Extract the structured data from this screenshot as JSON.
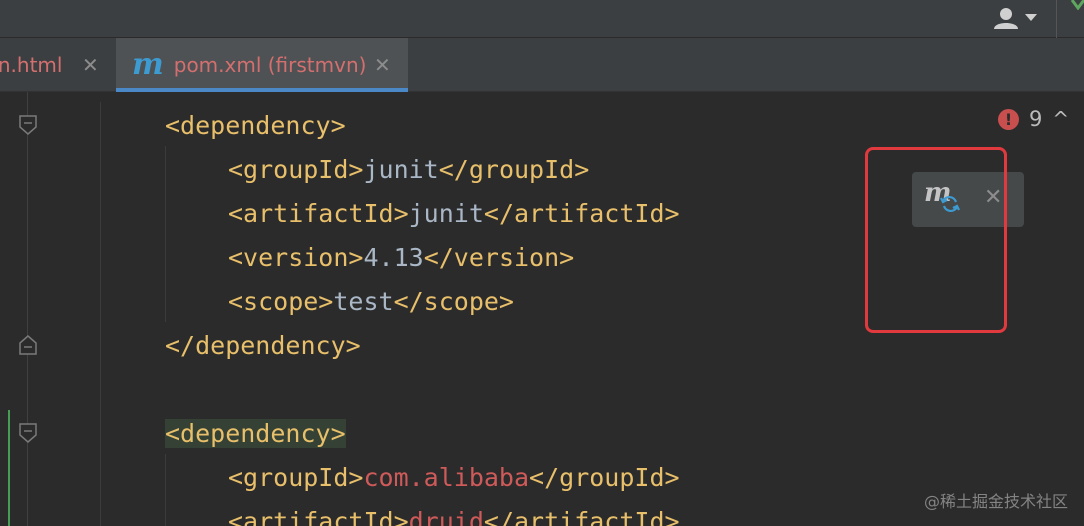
{
  "toolbar": {
    "user_icon": "user-icon",
    "dropdown_icon": "chevron-down-icon"
  },
  "tabs": [
    {
      "label": "rn.html",
      "close": "✕",
      "active": false
    },
    {
      "logo": "m",
      "label": "pom.xml (firstmvn)",
      "close": "✕",
      "active": true
    }
  ],
  "inspection": {
    "error_icon": "!",
    "count": "9",
    "arrow": "^"
  },
  "maven_popup": {
    "logo": "m",
    "reload_icon": "reload-icon",
    "close": "✕"
  },
  "code": [
    {
      "indent": "    ",
      "open": "<dependency>"
    },
    {
      "indent": "        ",
      "open": "<groupId>",
      "text": "junit",
      "close": "</groupId>"
    },
    {
      "indent": "        ",
      "open": "<artifactId>",
      "text": "junit",
      "close": "</artifactId>"
    },
    {
      "indent": "        ",
      "open": "<version>",
      "text": "4.13",
      "close": "</version>"
    },
    {
      "indent": "        ",
      "open": "<scope>",
      "text": "test",
      "close": "</scope>"
    },
    {
      "indent": "    ",
      "open": "</dependency>"
    },
    {
      "indent": "",
      "open": ""
    },
    {
      "indent": "    ",
      "open": "<dependency>"
    },
    {
      "indent": "        ",
      "open": "<groupId>",
      "text": "com.alibaba",
      "close": "</groupId>"
    },
    {
      "indent": "        ",
      "open": "<artifactId>",
      "text": "druid",
      "close": "</artifactId>"
    }
  ],
  "watermark": "@稀土掘金技术社区",
  "colors": {
    "tag": "#e8bf6a",
    "text": "#a9b7c6",
    "unresolved": "#cf5a5a",
    "accent_blue": "#3d9bd1",
    "error_red": "#c94f4f",
    "highlight_box": "#e0393e"
  }
}
